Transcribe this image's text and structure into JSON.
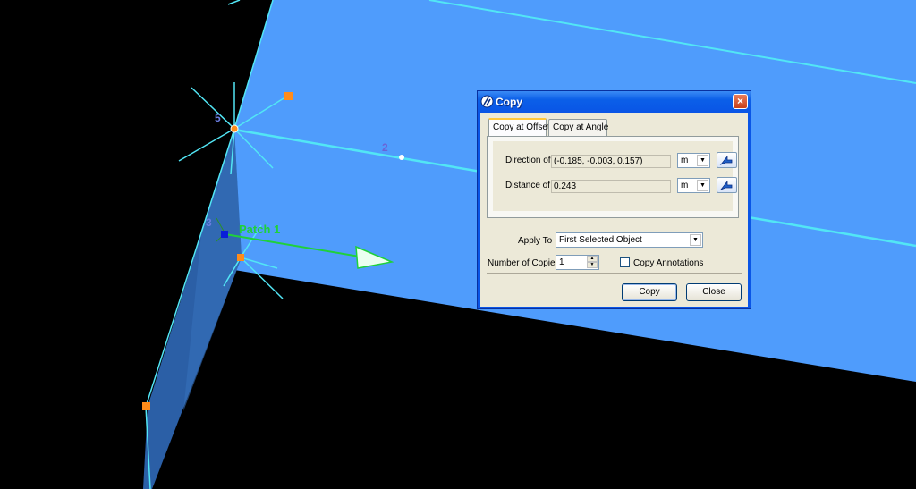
{
  "viewport": {
    "background": "#000000",
    "plane_color": "#4f9cfc",
    "edge_color": "#52e6f5",
    "handle_color": "#ff8c1a",
    "patch_label": "Patch 1",
    "vertex_labels": [
      "5",
      "2",
      "3"
    ]
  },
  "dialog": {
    "title": "Copy",
    "close_glyph": "×",
    "tabs": [
      "Copy at Offset",
      "Copy at Angle"
    ],
    "active_tab": "Copy at Offset",
    "direction": {
      "label": "Direction of Move",
      "value": "(-0.185, -0.003, 0.157)",
      "unit": "m"
    },
    "distance": {
      "label": "Distance of Move",
      "value": "0.243",
      "unit": "m"
    },
    "apply_to": {
      "label": "Apply To",
      "value": "First Selected Object"
    },
    "copies": {
      "label": "Number of Copies",
      "value": "1"
    },
    "copy_annotations": {
      "label": "Copy Annotations",
      "checked": false
    },
    "buttons": {
      "copy": "Copy",
      "close": "Close"
    }
  }
}
